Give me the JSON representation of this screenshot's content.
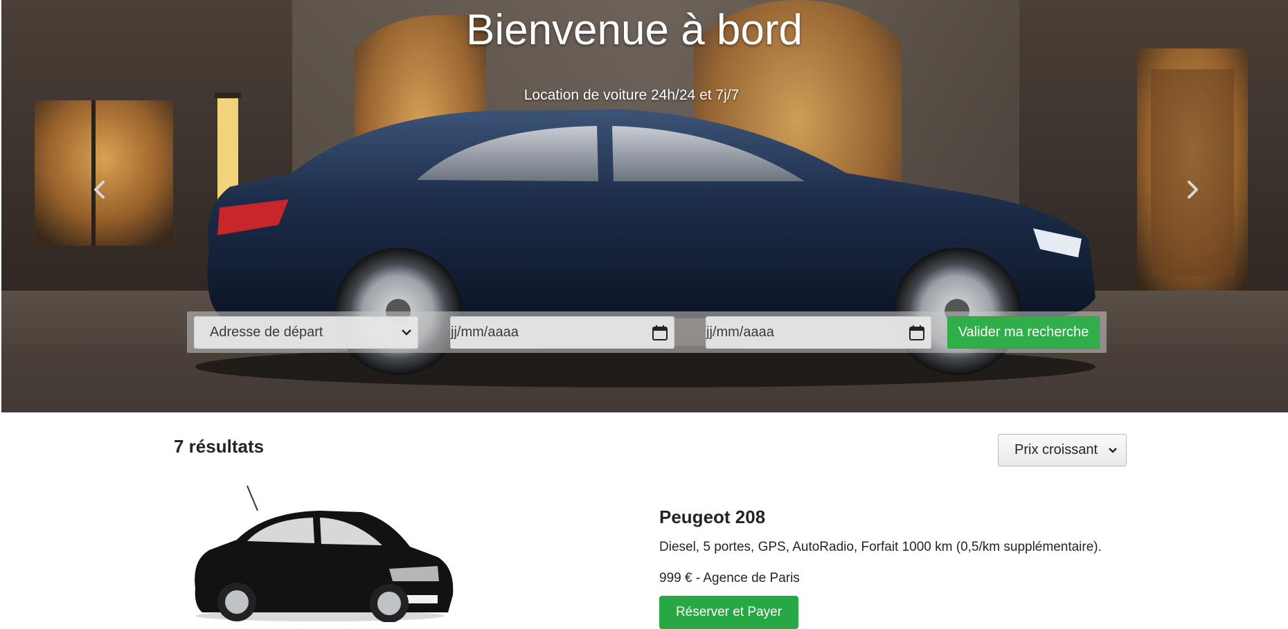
{
  "hero": {
    "title": "Bienvenue à bord",
    "subtitle": "Location de voiture 24h/24 et 7j/7",
    "prev_icon": "chevron-left-icon",
    "next_icon": "chevron-right-icon"
  },
  "search": {
    "departure_select": {
      "selected": "Adresse de départ",
      "icon": "chevron-down-icon"
    },
    "start_date": {
      "placeholder": "jj/mm/aaaa",
      "icon": "calendar-icon"
    },
    "end_date": {
      "placeholder": "jj/mm/aaaa",
      "icon": "calendar-icon"
    },
    "submit_label": "Valider ma recherche",
    "submit_color": "#2fae4a"
  },
  "results": {
    "count_label": "7 résultats",
    "sort": {
      "selected": "Prix croissant",
      "icon": "chevron-down-icon"
    },
    "items": [
      {
        "name": "Peugeot 208",
        "description": "Diesel, 5 portes, GPS, AutoRadio, Forfait 1000 km (0,5/km supplémentaire).",
        "price_line": "999 € - Agence de Paris",
        "cta_label": "Réserver et Payer",
        "cta_color": "#28a745"
      }
    ]
  }
}
